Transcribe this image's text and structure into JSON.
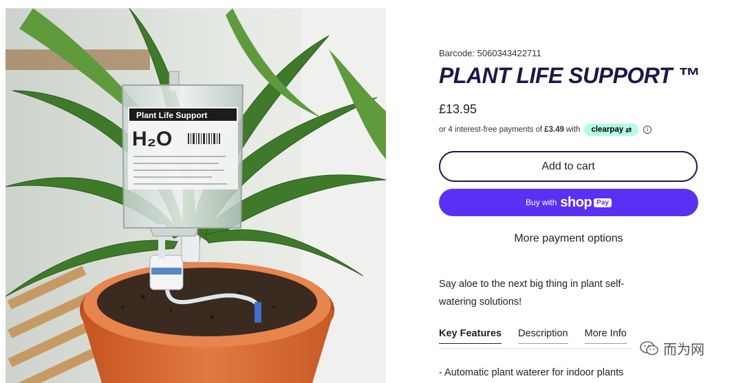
{
  "product": {
    "barcode": "Barcode: 5060343422711",
    "title": "PLANT LIFE SUPPORT ™",
    "price": "£13.95",
    "installments_prefix": "or 4 interest-free payments of",
    "installment_amount": "£3.49",
    "installments_suffix": "with",
    "clearpay_label": "clearpay",
    "info_icon": "info-icon",
    "tagline": "Say aloe to the next big thing in plant self-watering solutions!"
  },
  "actions": {
    "add_to_cart": "Add to cart",
    "buy_with": "Buy with",
    "shop_logo": "shop",
    "pay_tag": "Pay",
    "more_payment_options": "More payment options"
  },
  "tabs": [
    {
      "label": "Key Features",
      "active": true
    },
    {
      "label": "Description",
      "active": false
    },
    {
      "label": "More Info",
      "active": false
    }
  ],
  "features": [
    "- Automatic plant waterer for indoor plants"
  ],
  "image": {
    "bag_label": "Plant Life Support",
    "bag_big_text": "H₂O"
  },
  "watermark": {
    "text": "而为网",
    "icon": "wechat-icon"
  },
  "colors": {
    "title": "#1c1745",
    "shop_pay": "#5a31f4",
    "clearpay": "#b2fce4",
    "pot": "#d9662f"
  }
}
